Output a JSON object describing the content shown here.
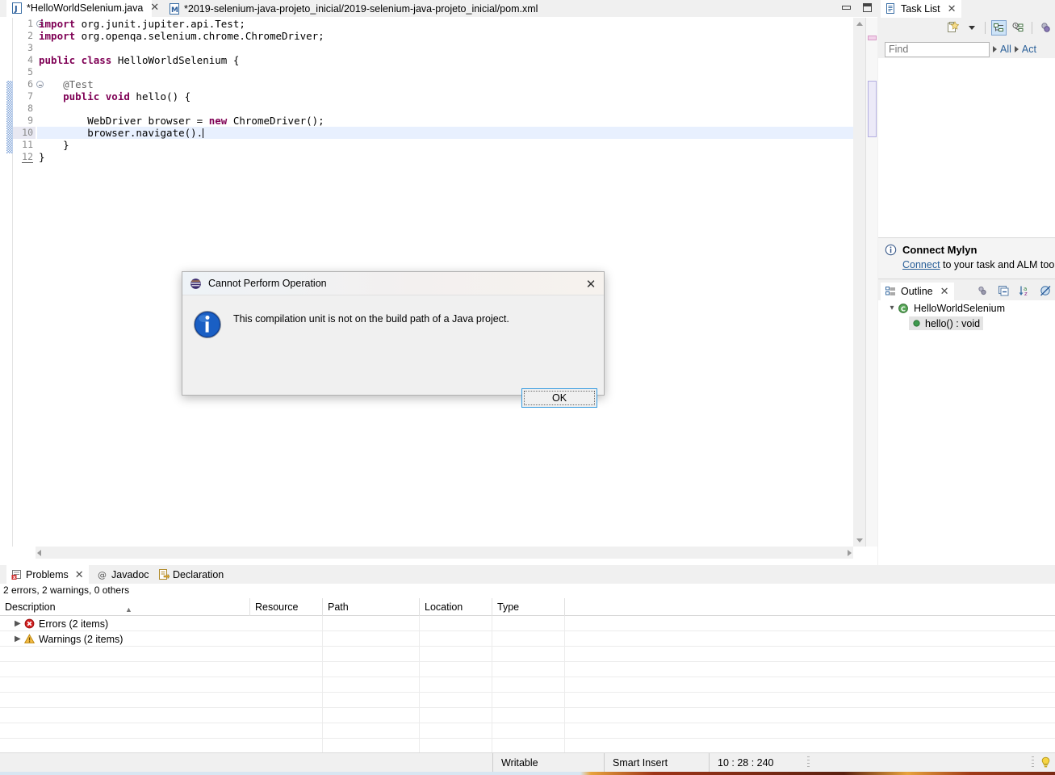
{
  "editor": {
    "tabs": [
      {
        "label": "*HelloWorldSelenium.java",
        "icon": "java-file-icon",
        "active": true,
        "closable": true
      },
      {
        "label": "*2019-selenium-java-projeto_inicial/2019-selenium-java-projeto_inicial/pom.xml",
        "icon": "maven-file-icon",
        "active": false,
        "closable": false
      }
    ],
    "minimize_label": "Minimize",
    "maximize_label": "Maximize",
    "lines": [
      {
        "no": "1",
        "fold": true,
        "hl": false,
        "tokens": [
          {
            "t": "import",
            "c": "kw"
          },
          {
            "t": " org.junit.jupiter.api.Test;",
            "c": "pl"
          }
        ]
      },
      {
        "no": "2",
        "fold": false,
        "hl": false,
        "tokens": [
          {
            "t": "import",
            "c": "kw"
          },
          {
            "t": " org.openqa.selenium.chrome.ChromeDriver;",
            "c": "pl"
          }
        ]
      },
      {
        "no": "3",
        "fold": false,
        "hl": false,
        "tokens": [
          {
            "t": "",
            "c": "pl"
          }
        ]
      },
      {
        "no": "4",
        "fold": false,
        "hl": false,
        "tokens": [
          {
            "t": "public class",
            "c": "kw"
          },
          {
            "t": " HelloWorldSelenium {",
            "c": "pl"
          }
        ]
      },
      {
        "no": "5",
        "fold": false,
        "hl": false,
        "tokens": [
          {
            "t": "",
            "c": "pl"
          }
        ]
      },
      {
        "no": "6",
        "fold": true,
        "hl": false,
        "tokens": [
          {
            "t": "    @Test",
            "c": "ann"
          }
        ]
      },
      {
        "no": "7",
        "fold": false,
        "hl": false,
        "tokens": [
          {
            "t": "    public void",
            "c": "kw"
          },
          {
            "t": " hello() {",
            "c": "pl"
          }
        ]
      },
      {
        "no": "8",
        "fold": false,
        "hl": false,
        "tokens": [
          {
            "t": "",
            "c": "pl"
          }
        ]
      },
      {
        "no": "9",
        "fold": false,
        "hl": false,
        "tokens": [
          {
            "t": "        WebDriver browser = ",
            "c": "pl"
          },
          {
            "t": "new",
            "c": "kw"
          },
          {
            "t": " ChromeDriver();",
            "c": "pl"
          }
        ]
      },
      {
        "no": "10",
        "fold": false,
        "hl": true,
        "caret": true,
        "tokens": [
          {
            "t": "        browser.navigate().",
            "c": "pl"
          }
        ]
      },
      {
        "no": "11",
        "fold": false,
        "hl": false,
        "tokens": [
          {
            "t": "    }",
            "c": "pl"
          }
        ]
      },
      {
        "no": "12",
        "fold": false,
        "hl": false,
        "last": true,
        "tokens": [
          {
            "t": "}",
            "c": "pl"
          }
        ]
      }
    ]
  },
  "task_list": {
    "tab_label": "Task List",
    "tab_icon": "task-list-icon",
    "toolbar": [
      {
        "name": "new-task-icon",
        "label": "New Task"
      },
      {
        "name": "chevron-down-icon",
        "label": "New Task Menu"
      },
      {
        "name": "categorized-presentation-icon",
        "label": "Categorized",
        "selected": true
      },
      {
        "name": "scheduled-presentation-icon",
        "label": "Scheduled",
        "selected": false
      },
      {
        "name": "focus-on-workweek-icon",
        "label": "Focus on Workweek"
      }
    ],
    "find_placeholder": "Find",
    "find_value": "",
    "filters": [
      {
        "label": "All",
        "arrow": true
      },
      {
        "label": "Act",
        "arrow": true
      }
    ]
  },
  "mylyn": {
    "icon": "info-circle-icon",
    "title": "Connect Mylyn",
    "link_text": "Connect",
    "rest_text": " to your task and ALM tools"
  },
  "outline": {
    "tab_label": "Outline",
    "tab_icon": "outline-icon",
    "toolbar": [
      {
        "name": "hide-fields-icon",
        "label": "Hide Fields"
      },
      {
        "name": "collapse-all-icon",
        "label": "Collapse All"
      },
      {
        "name": "sort-alphabetically-icon",
        "label": "Sort"
      },
      {
        "name": "hide-non-public-icon",
        "label": "Hide Non-Public Members"
      }
    ],
    "tree": [
      {
        "label": "HelloWorldSelenium",
        "icon": "java-class-icon",
        "expanded": true,
        "depth": 0,
        "selected": false
      },
      {
        "label": "hello() : void",
        "icon": "method-public-icon",
        "expanded": null,
        "depth": 1,
        "selected": true
      }
    ]
  },
  "bottom_panel": {
    "tabs": [
      {
        "label": "Problems",
        "icon": "problems-icon",
        "active": true,
        "closable": true
      },
      {
        "label": "Javadoc",
        "icon": "javadoc-icon",
        "active": false,
        "closable": false
      },
      {
        "label": "Declaration",
        "icon": "declaration-icon",
        "active": false,
        "closable": false
      }
    ],
    "summary": "2 errors, 2 warnings, 0 others",
    "columns": [
      {
        "label": "Description",
        "sorted": true
      },
      {
        "label": "Resource",
        "sorted": false
      },
      {
        "label": "Path",
        "sorted": false
      },
      {
        "label": "Location",
        "sorted": false
      },
      {
        "label": "Type",
        "sorted": false
      }
    ],
    "rows": [
      {
        "description": "Errors (2 items)",
        "icon": "error-icon",
        "expandable": true,
        "resource": "",
        "path": "",
        "location": "",
        "type": ""
      },
      {
        "description": "Warnings (2 items)",
        "icon": "warning-icon",
        "expandable": true,
        "resource": "",
        "path": "",
        "location": "",
        "type": ""
      }
    ],
    "empty_row_count": 7
  },
  "status_bar": {
    "writable": "Writable",
    "insert_mode": "Smart Insert",
    "position": "10 : 28 : 240",
    "quick_access_icon": "lightbulb-icon"
  },
  "dialog": {
    "title": "Cannot Perform Operation",
    "title_icon": "eclipse-icon",
    "close_label": "Close",
    "message_icon": "info-icon",
    "message": "This compilation unit is not on the build path of a Java project.",
    "ok_label": "OK"
  },
  "colors": {
    "accent_blue": "#2a6099",
    "keyword_purple": "#7f0055",
    "error_red": "#d32020",
    "warning_amber": "#f0a830",
    "selection_blue": "#e8f0fe",
    "panel_gray": "#f0f0f0"
  }
}
